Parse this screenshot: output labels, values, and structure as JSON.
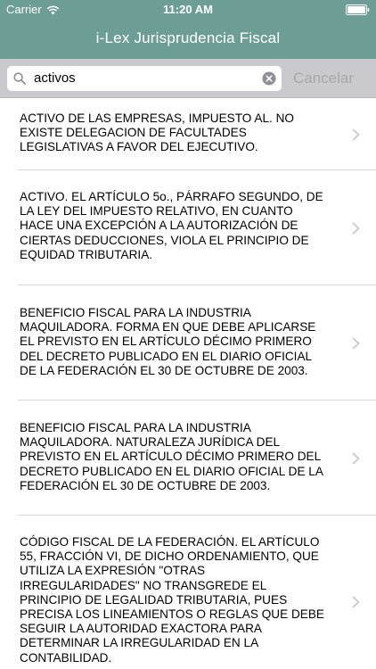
{
  "status_bar": {
    "carrier": "Carrier",
    "time": "11:20 AM"
  },
  "nav": {
    "title": "i-Lex Jurisprudencia Fiscal"
  },
  "search": {
    "value": "activos",
    "cancel_label": "Cancelar"
  },
  "results": [
    {
      "text": "ACTIVO DE LAS EMPRESAS, IMPUESTO AL. NO EXISTE DELEGACION DE FACULTADES LEGISLATIVAS A FAVOR DEL EJECUTIVO."
    },
    {
      "text": "ACTIVO. EL ARTÍCULO 5o., PÁRRAFO SEGUNDO, DE LA LEY DEL IMPUESTO RELATIVO, EN CUANTO HACE UNA EXCEPCIÓN A LA AUTORIZACIÓN DE CIERTAS DEDUCCIONES, VIOLA EL PRINCIPIO DE EQUIDAD TRIBUTARIA."
    },
    {
      "text": "BENEFICIO FISCAL PARA LA INDUSTRIA MAQUILADORA. FORMA EN QUE DEBE APLICARSE EL PREVISTO EN EL ARTÍCULO DÉCIMO PRIMERO DEL DECRETO PUBLICADO EN EL DIARIO OFICIAL DE LA FEDERACIÓN EL 30 DE OCTUBRE DE 2003."
    },
    {
      "text": "BENEFICIO FISCAL PARA LA INDUSTRIA MAQUILADORA. NATURALEZA JURÍDICA DEL PREVISTO EN EL ARTÍCULO DÉCIMO PRIMERO DEL DECRETO PUBLICADO EN EL DIARIO OFICIAL DE LA FEDERACIÓN EL 30 DE OCTUBRE DE 2003."
    },
    {
      "text": "CÓDIGO FISCAL DE LA FEDERACIÓN. EL ARTÍCULO 55, FRACCIÓN VI, DE DICHO ORDENAMIENTO, QUE UTILIZA LA EXPRESIÓN \"OTRAS IRREGULARIDADES\" NO TRANSGREDE EL PRINCIPIO DE LEGALIDAD TRIBUTARIA, PUES PRECISA LOS LINEAMIENTOS O REGLAS QUE DEBE SEGUIR LA AUTORIDAD EXACTORA PARA DETERMINAR LA IRREGULARIDAD EN LA CONTABILIDAD."
    }
  ],
  "colors": {
    "nav_background": "#6d9e96",
    "search_bar_background": "#c9c9ce",
    "cancel_text": "#a8a8ab"
  },
  "icons": [
    "wifi-icon",
    "battery-icon",
    "search-icon",
    "clear-icon",
    "chevron-right-icon"
  ]
}
